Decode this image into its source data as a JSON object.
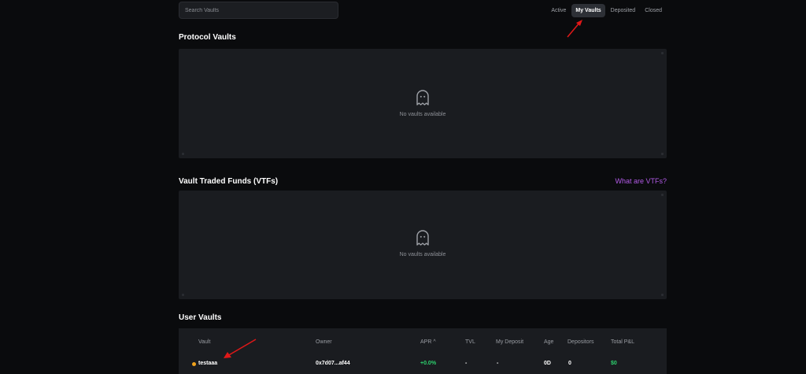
{
  "search": {
    "placeholder": "Search Vaults"
  },
  "filters": [
    {
      "label": "Active",
      "active": false
    },
    {
      "label": "My Vaults",
      "active": true
    },
    {
      "label": "Deposited",
      "active": false
    },
    {
      "label": "Closed",
      "active": false
    }
  ],
  "protocol_vaults": {
    "title": "Protocol Vaults",
    "empty_text": "No vaults available",
    "icon": "ghost-icon"
  },
  "vtfs": {
    "title": "Vault Traded Funds (VTFs)",
    "link": "What are VTFs?",
    "empty_text": "No vaults available",
    "icon": "ghost-icon"
  },
  "user_vaults": {
    "title": "User Vaults",
    "columns": [
      "Vault",
      "Owner",
      "APR",
      "TVL",
      "My Deposit",
      "Age",
      "Depositors",
      "Total P&L"
    ],
    "sort_indicator": "^",
    "rows": [
      {
        "vault": "testaaa",
        "owner": "0x7d07...af44",
        "apr": "+0.0%",
        "tvl": "-",
        "my_deposit": "-",
        "age": "0D",
        "depositors": "0",
        "pnl": "$0"
      }
    ]
  },
  "colors": {
    "accent_purple": "#b15ae6",
    "positive_green": "#2dd26e",
    "status_orange": "#f0a21c",
    "annotation_red": "#e01818"
  }
}
